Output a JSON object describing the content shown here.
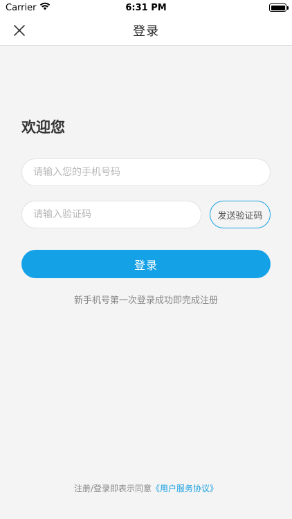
{
  "status_bar": {
    "carrier": "Carrier",
    "time": "6:31 PM",
    "battery_level": 1.0
  },
  "nav": {
    "title": "登录",
    "close_icon": "close-icon"
  },
  "main": {
    "welcome": "欢迎您",
    "phone_placeholder": "请输入您的手机号码",
    "code_placeholder": "请输入验证码",
    "send_code_label": "发送验证码",
    "login_label": "登录",
    "hint": "新手机号第一次登录成功即完成注册"
  },
  "footer": {
    "agreement_prefix": "注册/登录即表示同意",
    "agreement_link": "《用户服务协议》"
  },
  "colors": {
    "accent": "#14a1e6",
    "background": "#f4f4f4"
  }
}
